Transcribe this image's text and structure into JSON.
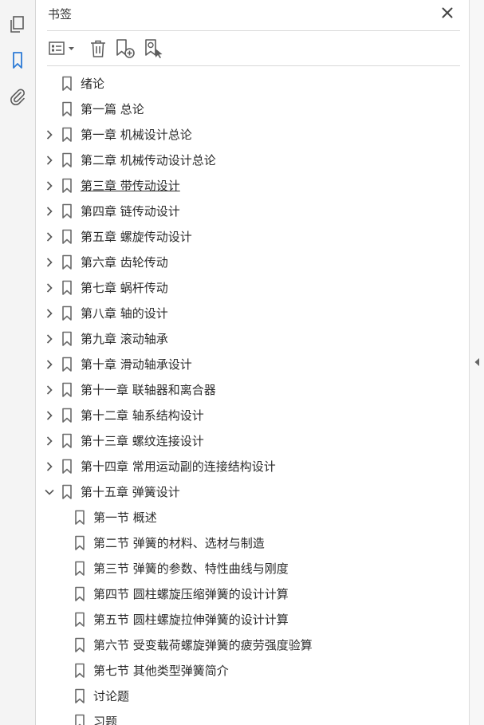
{
  "sidebar": {
    "icons": [
      "pages-icon",
      "bookmark-icon",
      "attachment-icon"
    ],
    "active": "bookmark-icon",
    "accent_color": "#2d7bd6"
  },
  "panel": {
    "title": "书签",
    "toolbar": [
      "options-menu-icon",
      "delete-bookmark-icon",
      "add-bookmark-icon",
      "find-current-bookmark-icon"
    ]
  },
  "bookmarks": [
    {
      "label": "绪论",
      "level": 0,
      "toggle": "none"
    },
    {
      "label": "第一篇 总论",
      "level": 0,
      "toggle": "none"
    },
    {
      "label": "第一章 机械设计总论",
      "level": 0,
      "toggle": "collapsed"
    },
    {
      "label": "第二章 机械传动设计总论",
      "level": 0,
      "toggle": "collapsed"
    },
    {
      "label": "第三章 带传动设计",
      "level": 0,
      "toggle": "collapsed",
      "hovered": true
    },
    {
      "label": "第四章 链传动设计",
      "level": 0,
      "toggle": "collapsed"
    },
    {
      "label": "第五章 螺旋传动设计",
      "level": 0,
      "toggle": "collapsed"
    },
    {
      "label": "第六章 齿轮传动",
      "level": 0,
      "toggle": "collapsed"
    },
    {
      "label": "第七章 蜗杆传动",
      "level": 0,
      "toggle": "collapsed"
    },
    {
      "label": "第八章 轴的设计",
      "level": 0,
      "toggle": "collapsed"
    },
    {
      "label": "第九章 滚动轴承",
      "level": 0,
      "toggle": "collapsed"
    },
    {
      "label": "第十章 滑动轴承设计",
      "level": 0,
      "toggle": "collapsed"
    },
    {
      "label": "第十一章 联轴器和离合器",
      "level": 0,
      "toggle": "collapsed"
    },
    {
      "label": "第十二章 轴系结构设计",
      "level": 0,
      "toggle": "collapsed"
    },
    {
      "label": "第十三章 螺纹连接设计",
      "level": 0,
      "toggle": "collapsed"
    },
    {
      "label": "第十四章 常用运动副的连接结构设计",
      "level": 0,
      "toggle": "collapsed"
    },
    {
      "label": "第十五章 弹簧设计",
      "level": 0,
      "toggle": "expanded"
    },
    {
      "label": "第一节 概述",
      "level": 1,
      "toggle": "none"
    },
    {
      "label": "第二节 弹簧的材料、选材与制造",
      "level": 1,
      "toggle": "none"
    },
    {
      "label": "第三节 弹簧的参数、特性曲线与刚度",
      "level": 1,
      "toggle": "none"
    },
    {
      "label": "第四节 圆柱螺旋压缩弹簧的设计计算",
      "level": 1,
      "toggle": "none"
    },
    {
      "label": "第五节 圆柱螺旋拉伸弹簧的设计计算",
      "level": 1,
      "toggle": "none"
    },
    {
      "label": "第六节 受变载荷螺旋弹簧的疲劳强度验算",
      "level": 1,
      "toggle": "none"
    },
    {
      "label": "第七节 其他类型弹簧简介",
      "level": 1,
      "toggle": "none"
    },
    {
      "label": "讨论题",
      "level": 1,
      "toggle": "none"
    },
    {
      "label": "习题",
      "level": 1,
      "toggle": "none"
    }
  ]
}
